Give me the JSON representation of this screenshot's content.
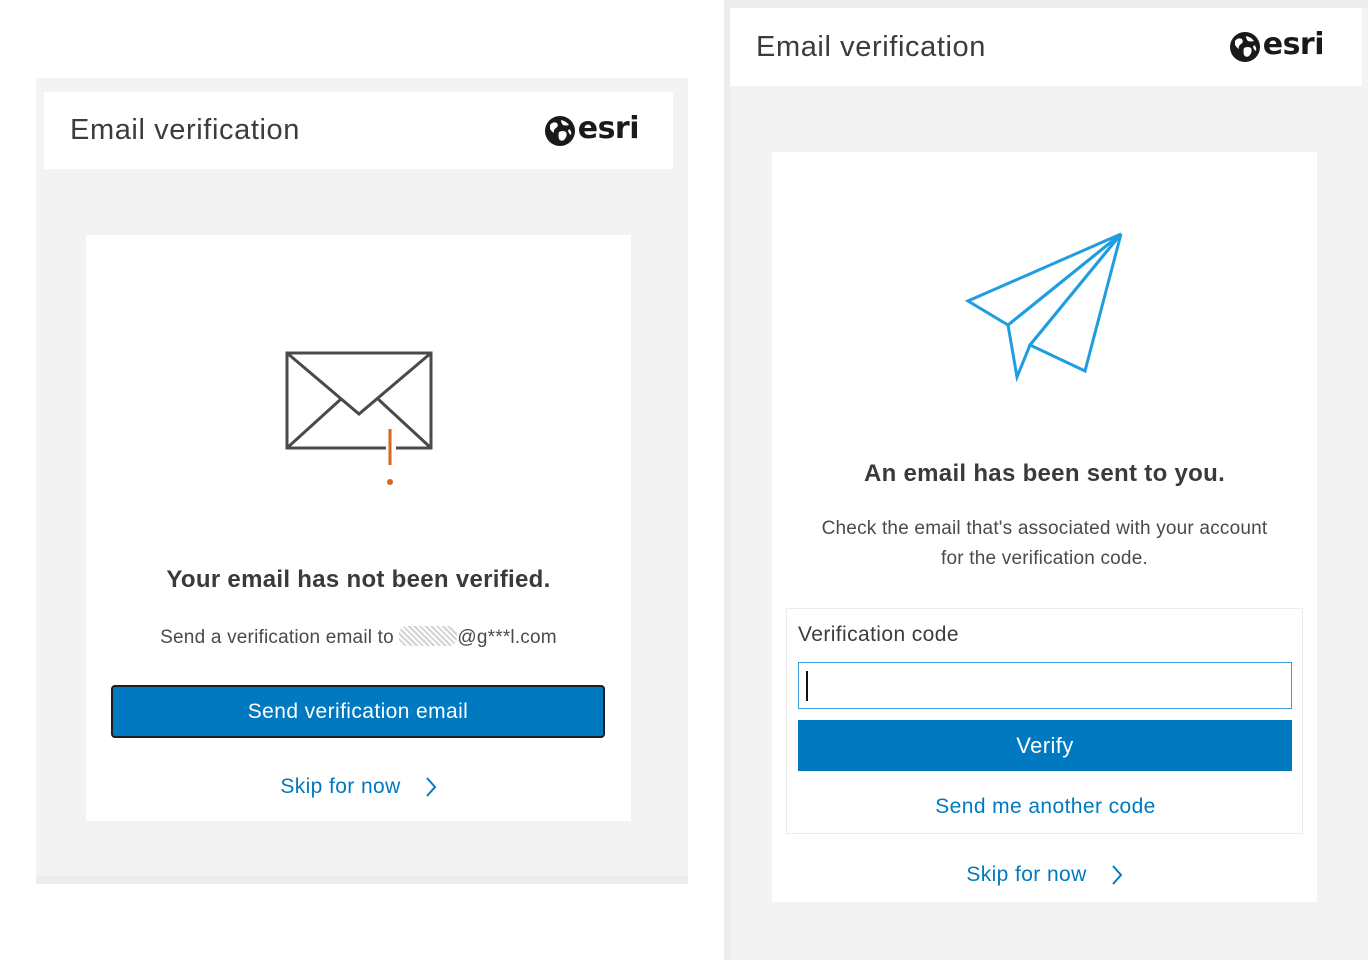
{
  "colors": {
    "accent": "#0079c1",
    "warning": "#d2691e",
    "panel_bg": "#f3f3f3",
    "card_bg": "#ffffff"
  },
  "left_screen": {
    "header": {
      "title": "Email verification",
      "logo_text": "esri"
    },
    "card": {
      "icon": "envelope-warning-icon",
      "heading": "Your email has not been verified.",
      "message_prefix": "Send a verification email to ",
      "email_masked_suffix": "@g***l.com",
      "send_button_label": "Send verification email",
      "skip_link_label": "Skip for now",
      "skip_icon": "chevron-right-icon"
    }
  },
  "right_screen": {
    "header": {
      "title": "Email verification",
      "logo_text": "esri"
    },
    "card": {
      "icon": "paper-plane-icon",
      "heading": "An email has been sent to you.",
      "message_line1": "Check the email that's associated with your account",
      "message_line2": "for the verification code.",
      "form": {
        "label": "Verification code",
        "input_value": "",
        "verify_button_label": "Verify",
        "resend_link_label": "Send me another code"
      },
      "skip_link_label": "Skip for now",
      "skip_icon": "chevron-right-icon"
    }
  }
}
